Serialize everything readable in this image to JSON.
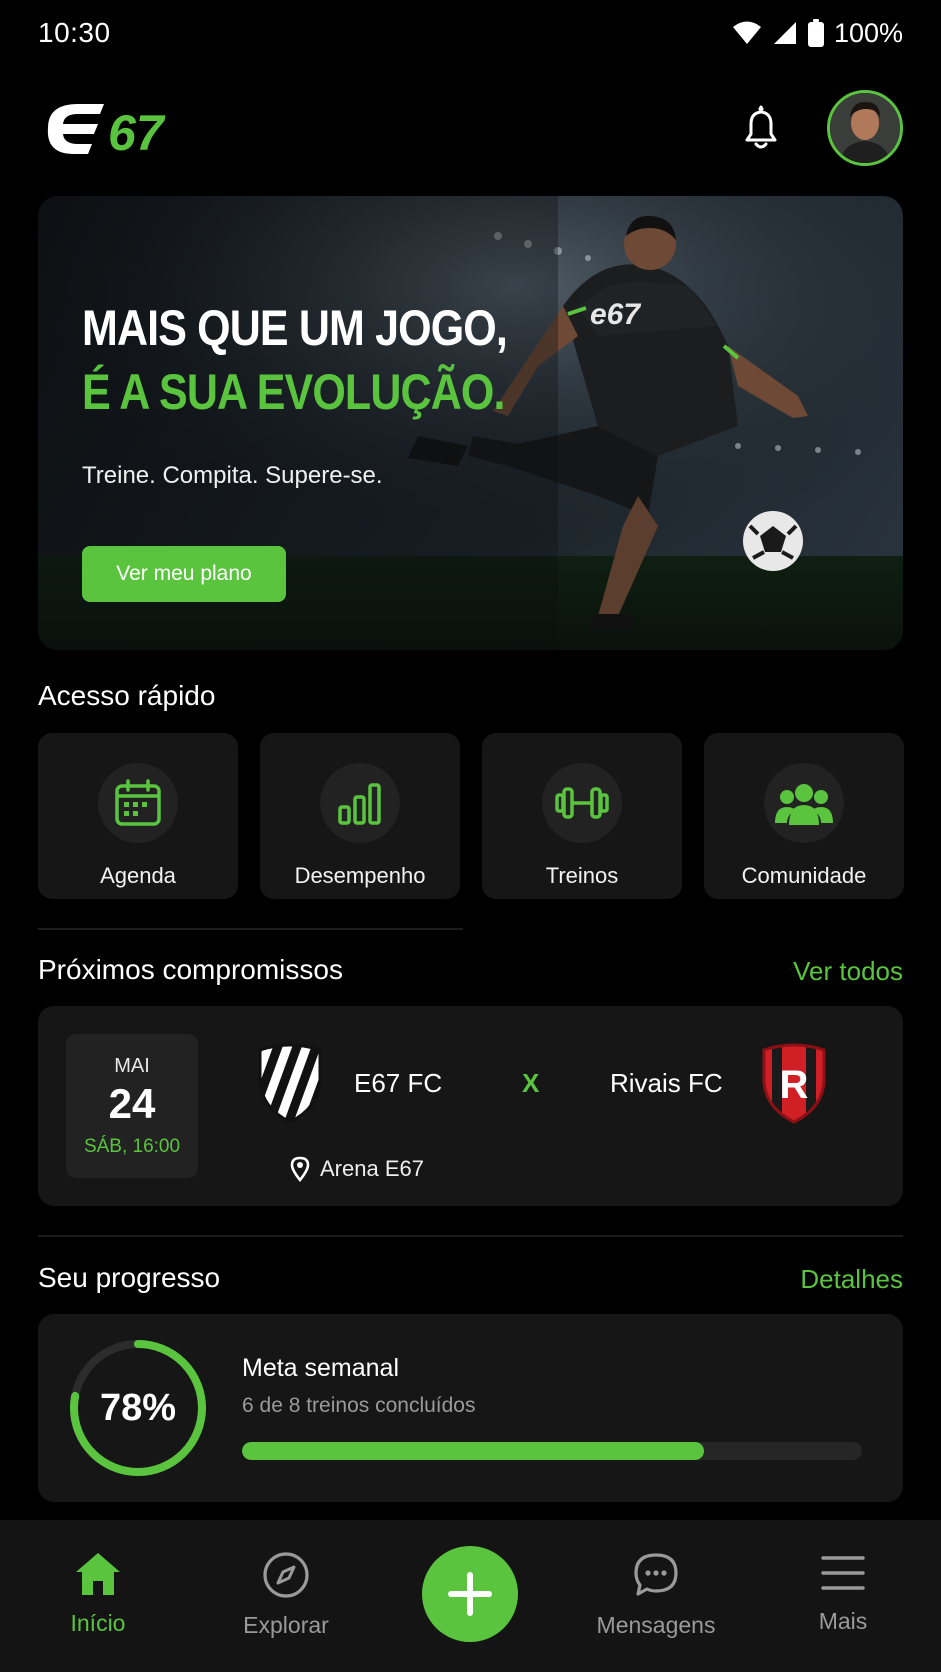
{
  "status_bar": {
    "time": "10:30",
    "battery": "100%"
  },
  "header": {
    "logo_text_e": "e",
    "logo_text_num": "67",
    "notification_icon": "bell-icon",
    "avatar": "user-avatar"
  },
  "hero": {
    "title_line1": "MAIS QUE UM JOGO,",
    "title_line2": "É A SUA EVOLUÇÃO.",
    "subtitle": "Treine. Compita. Supere-se.",
    "button_label": "Ver meu plano",
    "jersey_logo": "e67"
  },
  "quick_access": {
    "title": "Acesso rápido",
    "items": [
      {
        "label": "Agenda",
        "icon": "calendar-icon"
      },
      {
        "label": "Desempenho",
        "icon": "bar-chart-icon"
      },
      {
        "label": "Treinos",
        "icon": "dumbbell-icon"
      },
      {
        "label": "Comunidade",
        "icon": "community-icon"
      }
    ]
  },
  "appointments": {
    "title": "Próximos compromissos",
    "link": "Ver todos",
    "match": {
      "month": "MAI",
      "day": "24",
      "weekday_time": "SÁB, 16:00",
      "home_team": "E67 FC",
      "vs": "X",
      "away_team": "Rivais FC",
      "away_badge_letter": "R",
      "venue": "Arena E67"
    }
  },
  "progress": {
    "title": "Seu progresso",
    "link": "Detalhes",
    "percent_label": "78%",
    "percent_value": 0.78,
    "goal_title": "Meta semanal",
    "goal_sub": "6 de 8 treinos concluídos",
    "bar_fill": 0.745
  },
  "bottom_nav": {
    "items": [
      {
        "label": "Início",
        "icon": "home-icon",
        "active": true
      },
      {
        "label": "Explorar",
        "icon": "compass-icon",
        "active": false
      },
      {
        "label": "",
        "icon": "plus-icon",
        "active": false
      },
      {
        "label": "Mensagens",
        "icon": "chat-icon",
        "active": false
      },
      {
        "label": "Mais",
        "icon": "menu-icon",
        "active": false
      }
    ]
  },
  "colors": {
    "accent": "#5ac43f",
    "background": "#000000",
    "card": "#161616",
    "away_red": "#d11f26"
  }
}
